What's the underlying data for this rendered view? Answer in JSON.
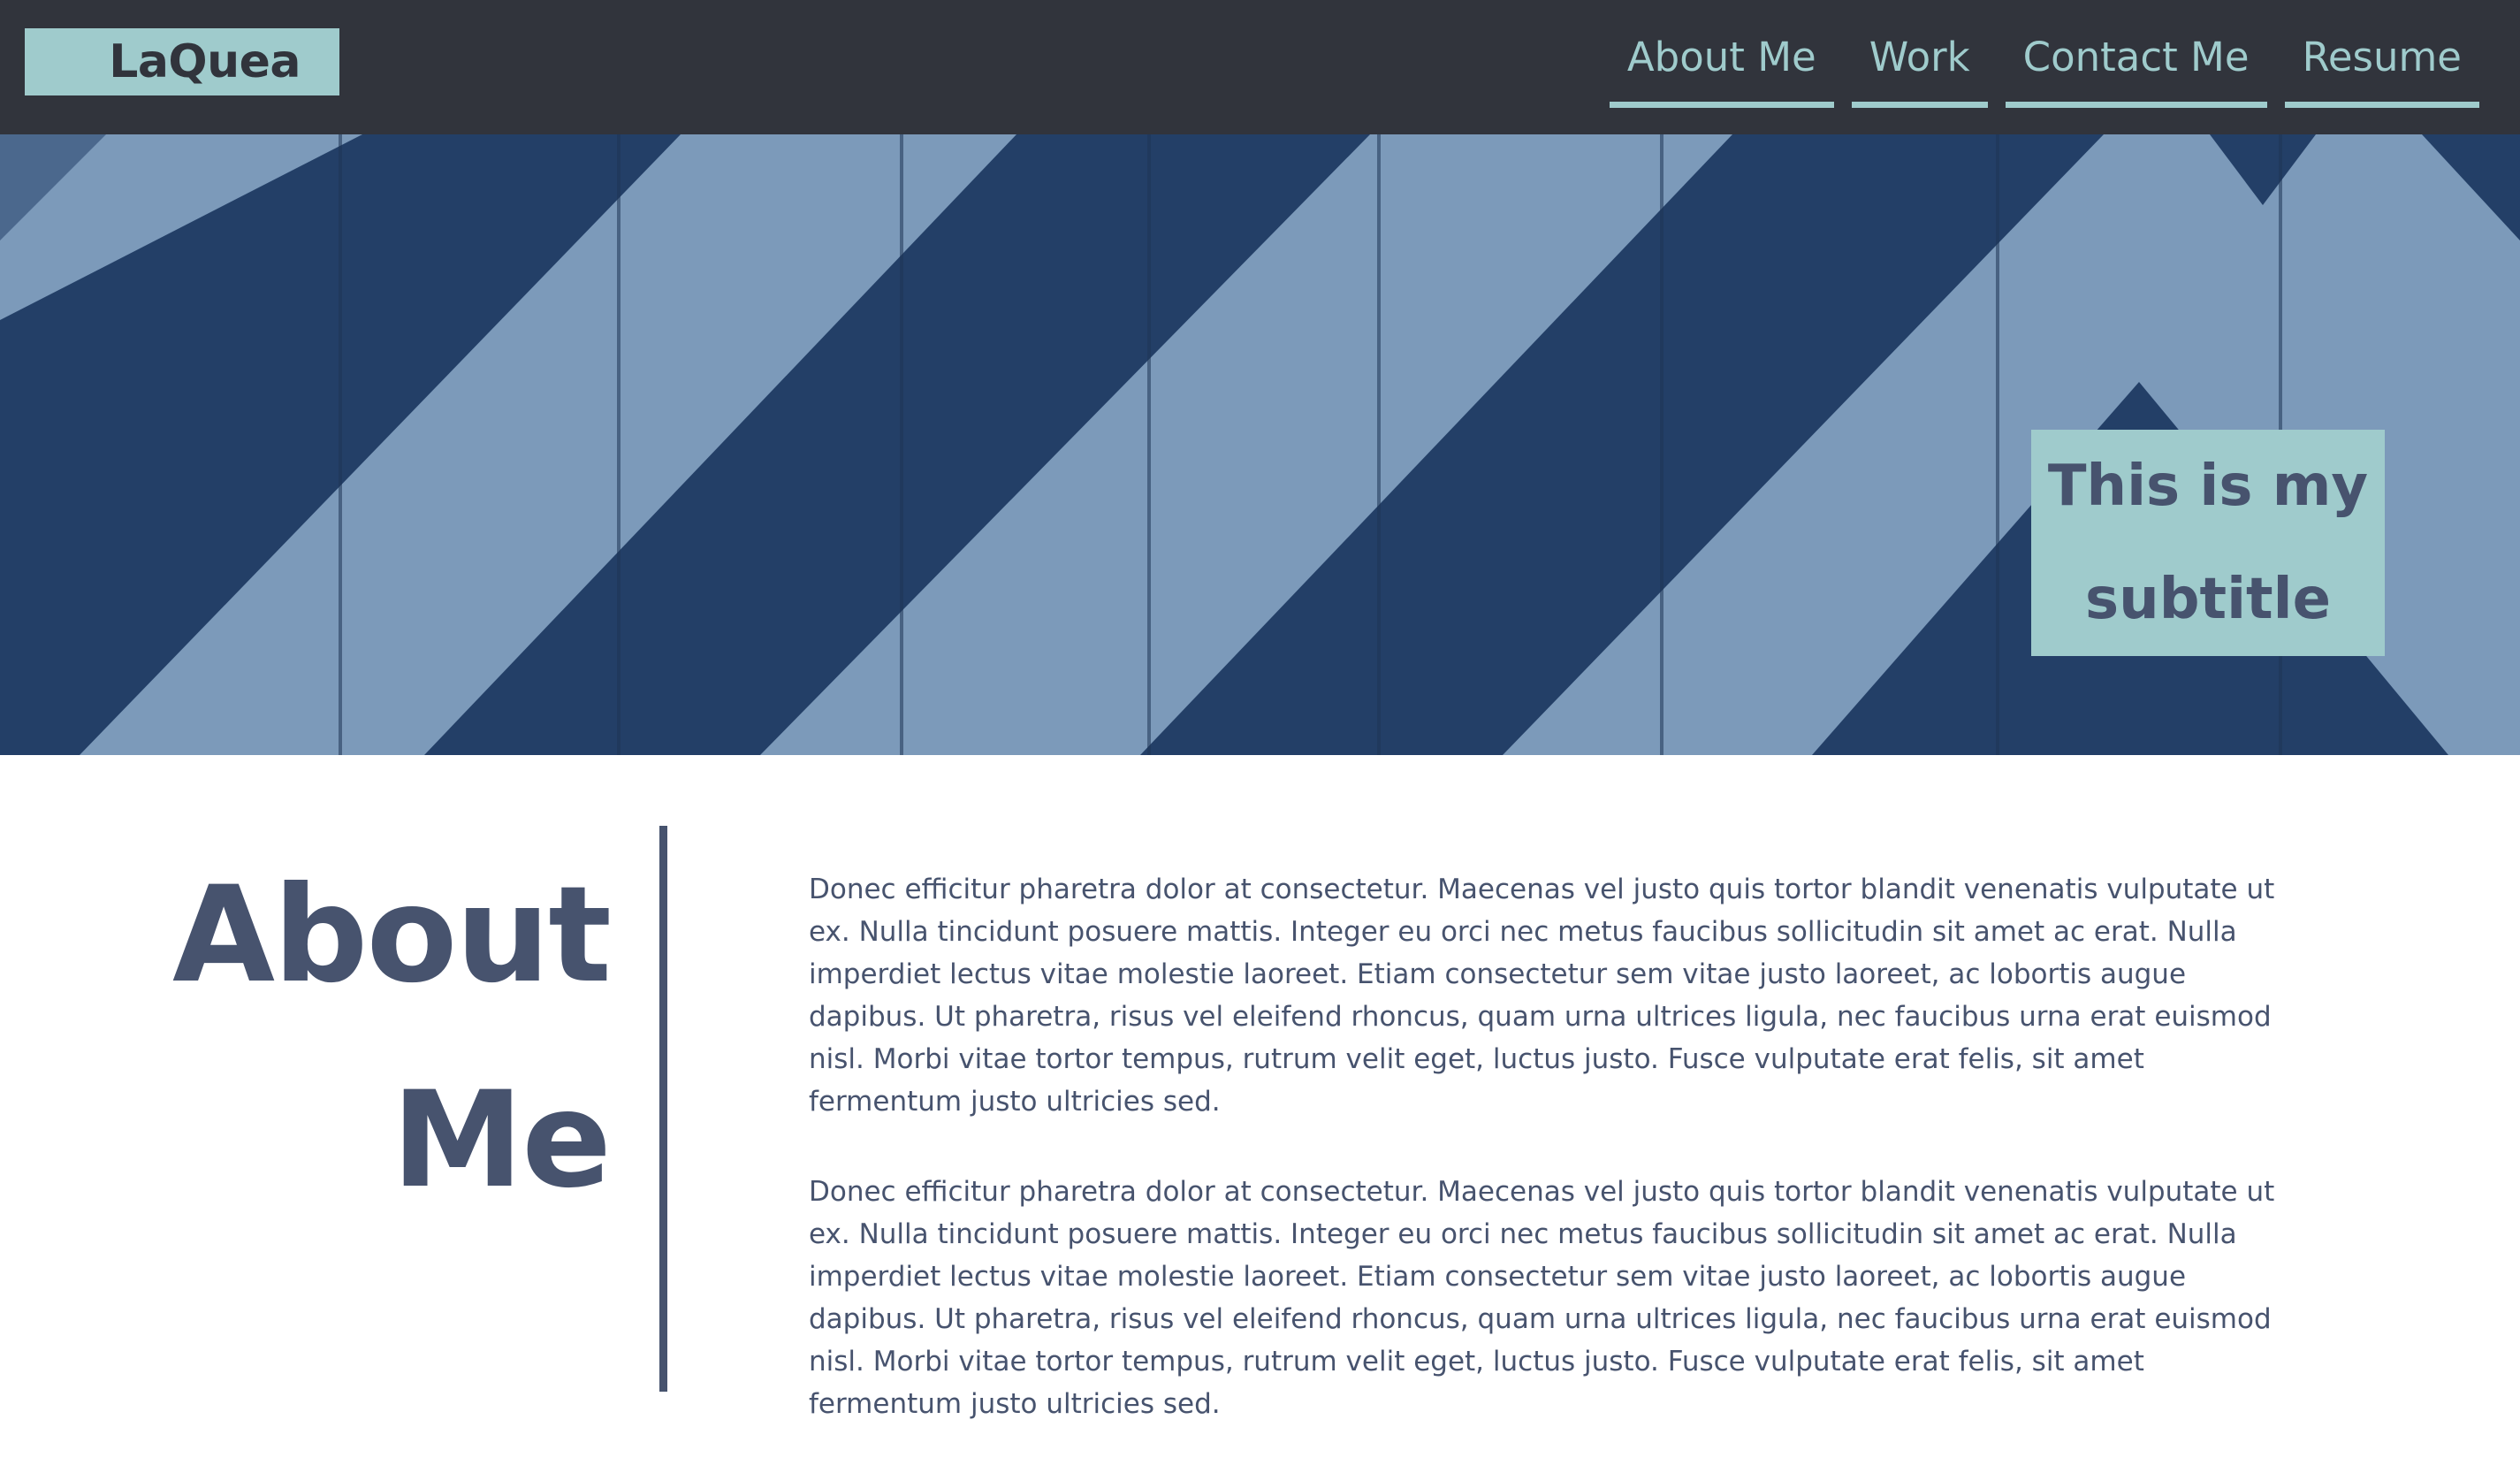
{
  "header": {
    "logo_text": "LaQuea",
    "nav": [
      {
        "label": "About Me"
      },
      {
        "label": "Work"
      },
      {
        "label": "Contact Me"
      },
      {
        "label": "Resume"
      }
    ]
  },
  "hero": {
    "subtitle": "This is my subtitle"
  },
  "about": {
    "title_line1": "About",
    "title_line2": "Me",
    "paragraphs": [
      "Donec efficitur pharetra dolor at consectetur. Maecenas vel justo quis tortor blandit venenatis vulputate ut ex. Nulla tincidunt posuere mattis. Integer eu orci nec metus faucibus sollicitudin sit amet ac erat. Nulla imperdiet lectus vitae molestie laoreet. Etiam consectetur sem vitae justo laoreet, ac lobortis augue dapibus. Ut pharetra, risus vel eleifend rhoncus, quam urna ultrices ligula, nec faucibus urna erat euismod nisl. Morbi vitae tortor tempus, rutrum velit eget, luctus justo. Fusce vulputate erat felis, sit amet fermentum justo ultricies sed.",
      "Donec efficitur pharetra dolor at consectetur. Maecenas vel justo quis tortor blandit venenatis vulputate ut ex. Nulla tincidunt posuere mattis. Integer eu orci nec metus faucibus sollicitudin sit amet ac erat. Nulla imperdiet lectus vitae molestie laoreet. Etiam consectetur sem vitae justo laoreet, ac lobortis augue dapibus. Ut pharetra, risus vel eleifend rhoncus, quam urna ultrices ligula, nec faucibus urna erat euismod nisl. Morbi vitae tortor tempus, rutrum velit eget, luctus justo. Fusce vulputate erat felis, sit amet fermentum justo ultricies sed."
    ]
  },
  "colors": {
    "header_bg": "#31343c",
    "accent": "#9fcbcc",
    "text": "#47536e",
    "hero_light": "#7c9aba",
    "hero_dark": "#233f67"
  }
}
